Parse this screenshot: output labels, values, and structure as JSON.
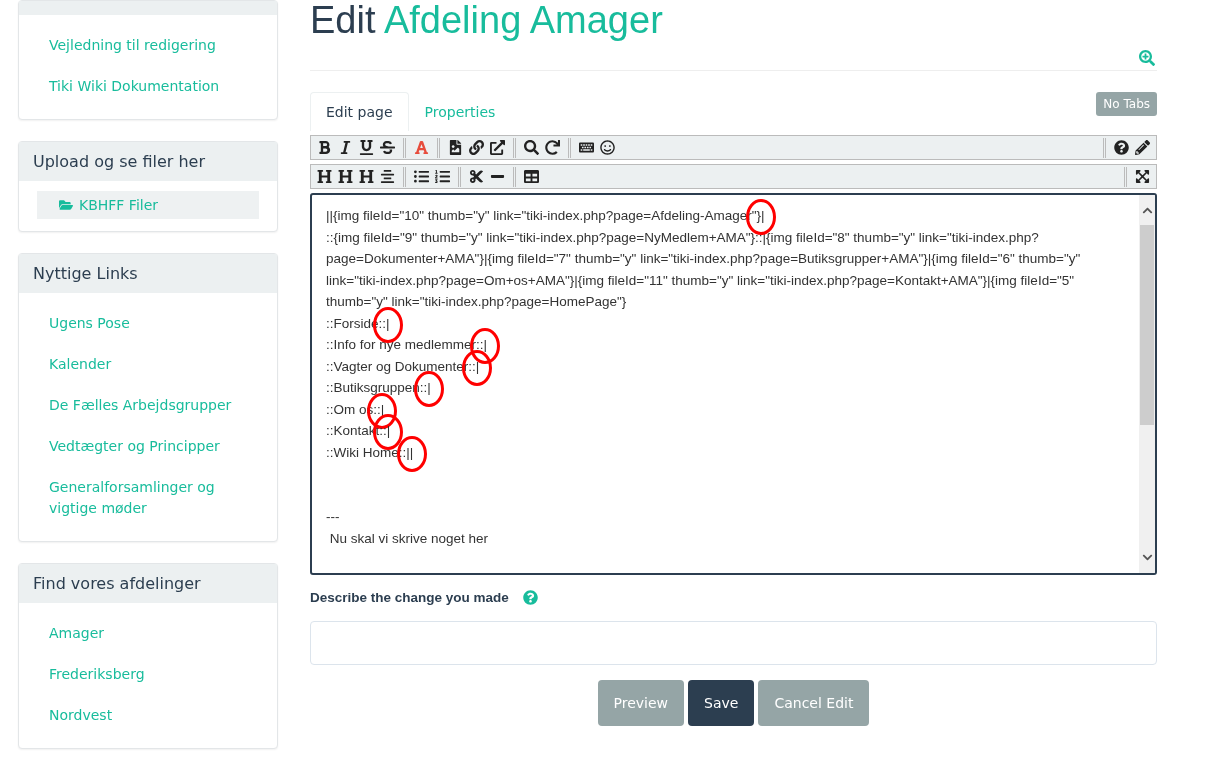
{
  "sidebar": {
    "cards": [
      {
        "items": [
          {
            "label": "Vejledning til redigering"
          },
          {
            "label": "Tiki Wiki Dokumentation"
          }
        ]
      },
      {
        "title": "Upload og se filer her",
        "kind": "files",
        "items": [
          {
            "label": "KBHFF Filer",
            "selected": true
          }
        ]
      },
      {
        "title": "Nyttige Links",
        "items": [
          {
            "label": "Ugens Pose"
          },
          {
            "label": "Kalender"
          },
          {
            "label": "De Fælles Arbejdsgrupper"
          },
          {
            "label": "Vedtægter og Principper"
          },
          {
            "label": "Generalforsamlinger og vigtige møder"
          }
        ]
      },
      {
        "title": "Find vores afdelinger",
        "items": [
          {
            "label": "Amager"
          },
          {
            "label": "Frederiksberg"
          },
          {
            "label": "Nordvest"
          }
        ]
      }
    ]
  },
  "heading": {
    "prefix": "Edit",
    "page_name": "Afdeling Amager"
  },
  "tabs": [
    {
      "label": "Edit page",
      "selected": true
    },
    {
      "label": "Properties",
      "selected": false
    }
  ],
  "no_tabs_button": "No Tabs",
  "editor": {
    "lines": [
      {
        "text": "||{img fileId=\"10\" thumb=\"y\" link=\"tiki-index.php?page=Afdeling-Amager\"}|",
        "circled": true
      },
      {
        "text": "::{img fileId=\"9\" thumb=\"y\" link=\"tiki-index.php?page=NyMedlem+AMA\"}::|{img fileId=\"8\" thumb=\"y\" link=\"tiki-index.php?page=Dokumenter+AMA\"}|{img fileId=\"7\" thumb=\"y\" link=\"tiki-index.php?page=Butiksgrupper+AMA\"}|{img fileId=\"6\" thumb=\"y\" link=\"tiki-index.php?page=Om+os+AMA\"}|{img fileId=\"11\" thumb=\"y\" link=\"tiki-index.php?page=Kontakt+AMA\"}|{img fileId=\"5\" thumb=\"y\" link=\"tiki-index.php?page=HomePage\"}",
        "circled": false
      },
      {
        "text": "::Forside::|",
        "circled": true
      },
      {
        "text": "::Info for nye medlemmer::|",
        "circled": true
      },
      {
        "text": "::Vagter og Dokumenter::|",
        "circled": true
      },
      {
        "text": "::Butiksgruppen::|",
        "circled": true
      },
      {
        "text": "::Om os::|",
        "circled": true
      },
      {
        "text": "::Kontakt::|",
        "circled": true
      },
      {
        "text": "::Wiki Home::||",
        "circled": true
      },
      {
        "text": "---",
        "circled": false,
        "gap_before": true
      },
      {
        "text": " Nu skal vi skrive noget her",
        "circled": false
      }
    ]
  },
  "describe_label": "Describe the change you made",
  "buttons": [
    {
      "label": "Preview",
      "kind": "secondary"
    },
    {
      "label": "Save",
      "kind": "primary"
    },
    {
      "label": "Cancel Edit",
      "kind": "secondary"
    }
  ]
}
